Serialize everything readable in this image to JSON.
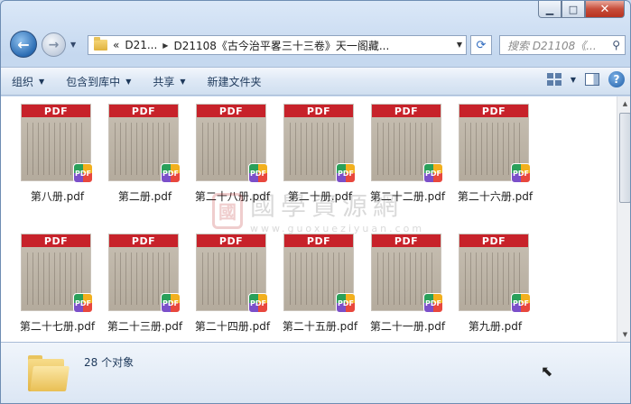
{
  "window": {
    "caption": {
      "minimize": "▭",
      "maximize": "□",
      "close": "✕"
    }
  },
  "address": {
    "overflow": "«",
    "crumbs": [
      "D21...",
      "D21108《古今治平畧三十三卷》天一阁藏..."
    ],
    "search_placeholder": "搜索 D21108《...",
    "search_icon": "search-icon"
  },
  "toolbar": {
    "organize": "组织",
    "include_in_library": "包含到库中",
    "share": "共享",
    "new_folder": "新建文件夹",
    "help": "?"
  },
  "files": [
    {
      "name": "第八册.pdf"
    },
    {
      "name": "第二册.pdf"
    },
    {
      "name": "第二十八册.pdf"
    },
    {
      "name": "第二十册.pdf"
    },
    {
      "name": "第二十二册.pdf"
    },
    {
      "name": "第二十六册.pdf"
    },
    {
      "name": "第二十七册.pdf"
    },
    {
      "name": "第二十三册.pdf"
    },
    {
      "name": "第二十四册.pdf"
    },
    {
      "name": "第二十五册.pdf"
    },
    {
      "name": "第二十一册.pdf"
    },
    {
      "name": "第九册.pdf"
    }
  ],
  "thumb_header": "PDF",
  "thumb_badge": "PDF",
  "watermark": {
    "seal": "國",
    "title": "國學資源網",
    "url": "www.guoxueziyuan.com"
  },
  "status": {
    "count_text": "28 个对象"
  }
}
